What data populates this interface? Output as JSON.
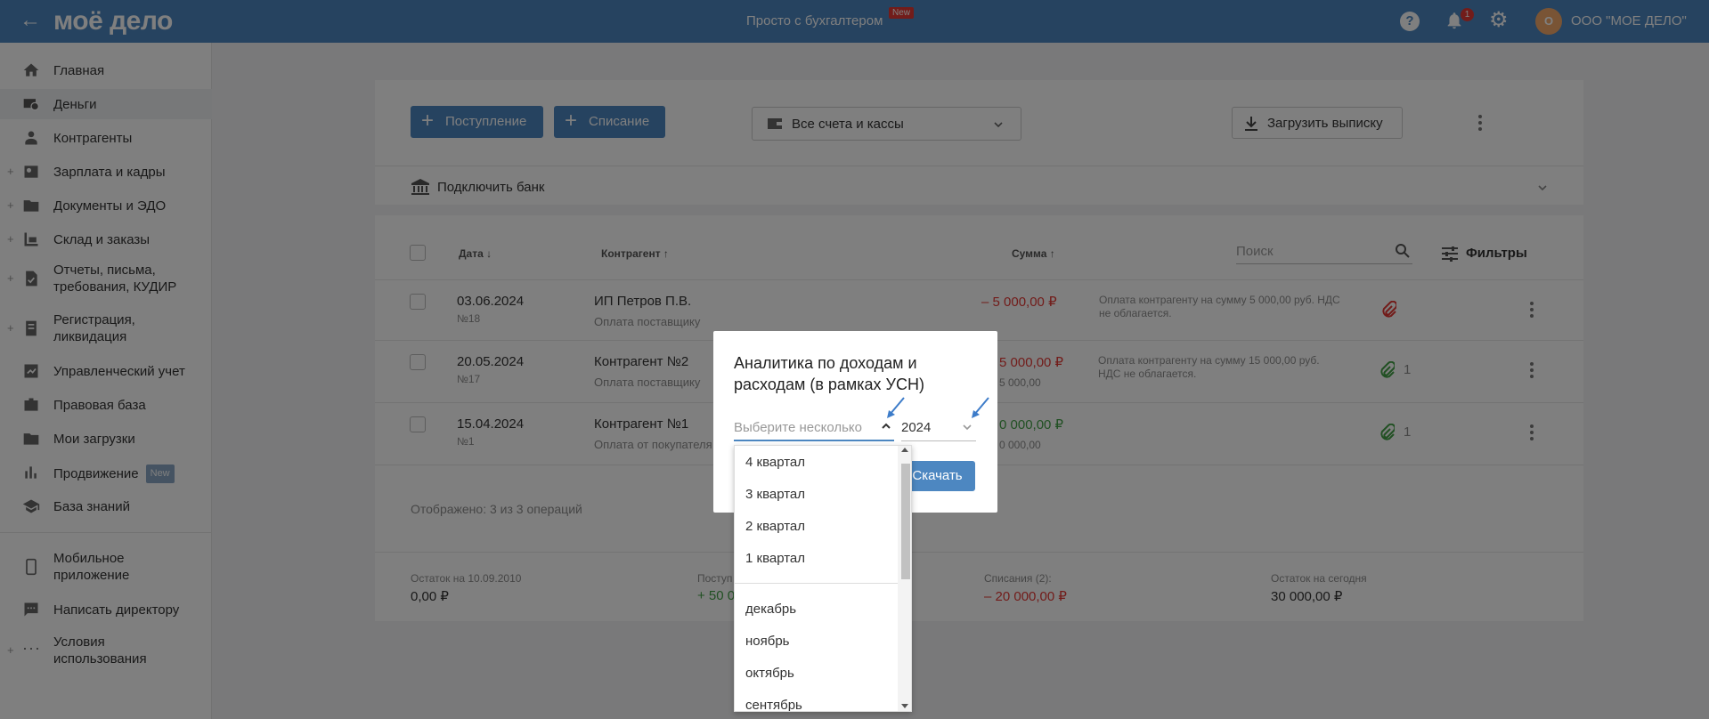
{
  "header": {
    "logo": "моё дело",
    "center_text": "Просто с бухгалтером",
    "center_badge": "New",
    "help": "?",
    "notifications_count": "1",
    "avatar_letter": "О",
    "company": "ООО \"МОЕ ДЕЛО\""
  },
  "sidebar": {
    "items": [
      {
        "label": "Главная",
        "icon": "home-icon"
      },
      {
        "label": "Деньги",
        "icon": "money-icon"
      },
      {
        "label": "Контрагенты",
        "icon": "contractors-icon"
      },
      {
        "label": "Зарплата и кадры",
        "icon": "salary-icon",
        "plus": "+"
      },
      {
        "label": "Документы и ЭДО",
        "icon": "folder-icon",
        "plus": "+"
      },
      {
        "label": "Склад и заказы",
        "icon": "warehouse-icon",
        "plus": "+"
      },
      {
        "label": "Отчеты, письма,",
        "label2": "требования, КУДИР",
        "icon": "reports-icon",
        "plus": "+"
      },
      {
        "label": "Регистрация,",
        "label2": "ликвидация",
        "icon": "registration-icon",
        "plus": "+"
      },
      {
        "label": "Управленческий учет",
        "icon": "management-icon"
      },
      {
        "label": "Правовая база",
        "icon": "briefcase-icon"
      },
      {
        "label": "Мои загрузки",
        "icon": "folder-icon"
      },
      {
        "label": "Продвижение",
        "badge": "New",
        "icon": "promo-icon"
      },
      {
        "label": "База знаний",
        "icon": "knowledge-icon"
      },
      {
        "label": "Мобильное",
        "label2": "приложение",
        "icon": "mobile-icon"
      },
      {
        "label": "Написать директору",
        "icon": "chat-icon"
      },
      {
        "label": "Условия",
        "label2": "использования",
        "icon": "dots-icon",
        "plus": "+"
      }
    ]
  },
  "toolbar": {
    "income_label": "Поступление",
    "expense_label": "Списание",
    "accounts_label": "Все счета и кассы",
    "upload_label": "Загрузить выписку",
    "connect_bank": "Подключить банк"
  },
  "table": {
    "headers": {
      "date": "Дата",
      "contractor": "Контрагент",
      "sum": "Сумма"
    },
    "search_placeholder": "Поиск",
    "filters_label": "Фильтры",
    "rows": [
      {
        "date": "03.06.2024",
        "num": "№18",
        "contractor": "ИП Петров П.В.",
        "type": "Оплата поставщику",
        "sum": "– 5 000,00 ₽",
        "sum2": "",
        "desc": "Оплата контрагенту на сумму 5 000,00 руб. НДС",
        "desc2": "не облагается.",
        "attach": ""
      },
      {
        "date": "20.05.2024",
        "num": "№17",
        "contractor": "Контрагент №2",
        "type": "Оплата поставщику",
        "sum": "5 000,00 ₽",
        "sum2": "5 000,00",
        "desc": "Оплата контрагенту на сумму 15 000,00 руб.",
        "desc2": "НДС не облагается.",
        "attach": "1"
      },
      {
        "date": "15.04.2024",
        "num": "№1",
        "contractor": "Контрагент №1",
        "type": "Оплата от покупателя",
        "sum": "0 000,00 ₽",
        "sum2": "0 000,00",
        "desc": "",
        "desc2": "",
        "attach": "1"
      }
    ],
    "shown_text": "Отображено: 3 из 3 операций"
  },
  "footer": {
    "balance_label": "Остаток на 10.09.2010",
    "balance_value": "0,00 ₽",
    "income_label": "Поступ",
    "income_value": "+ 50 0",
    "expense_label": "Списания (2):",
    "expense_value": "– 20 000,00 ₽",
    "today_label": "Остаток на сегодня",
    "today_value": "30 000,00 ₽"
  },
  "modal": {
    "title": "Аналитика по доходам и расходам (в рамках УСН)",
    "period_placeholder": "Выберите несколько",
    "year": "2024",
    "download_label": "Скачать"
  },
  "dropdown": {
    "quarters": [
      "4 квартал",
      "3 квартал",
      "2 квартал",
      "1 квартал"
    ],
    "months": [
      "декабрь",
      "ноябрь",
      "октябрь",
      "сентябрь"
    ]
  },
  "colors": {
    "brand": "#4d87c1",
    "negative": "#e53935",
    "positive": "#43a047"
  }
}
